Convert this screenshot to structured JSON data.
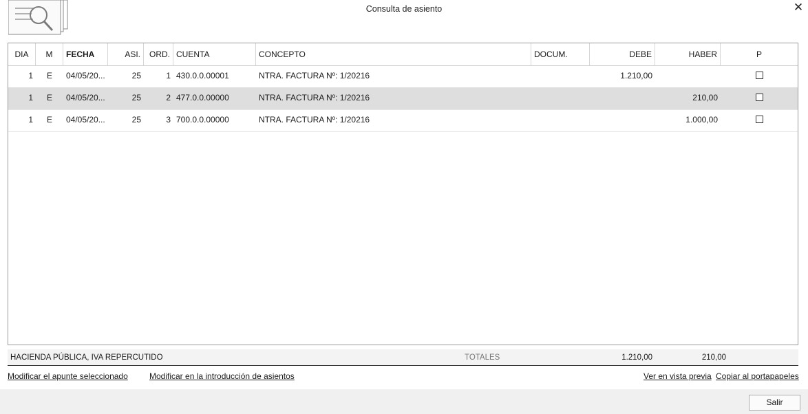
{
  "window": {
    "title": "Consulta de asiento",
    "close_symbol": "✕"
  },
  "columns": [
    "DIA",
    "M",
    "FECHA",
    "ASI.",
    "ORD.",
    "CUENTA",
    "CONCEPTO",
    "DOCUM.",
    "DEBE",
    "HABER",
    "P"
  ],
  "rows": [
    {
      "dia": "1",
      "m": "E",
      "fecha": "04/05/20...",
      "asi": "25",
      "ord": "1",
      "cuenta": "430.0.0.00001",
      "concepto": "NTRA. FACTURA Nº: 1/20216",
      "docum": "",
      "debe": "1.210,00",
      "haber": "",
      "p": false
    },
    {
      "dia": "1",
      "m": "E",
      "fecha": "04/05/20...",
      "asi": "25",
      "ord": "2",
      "cuenta": "477.0.0.00000",
      "concepto": "NTRA. FACTURA Nº: 1/20216",
      "docum": "",
      "debe": "",
      "haber": "210,00",
      "p": false
    },
    {
      "dia": "1",
      "m": "E",
      "fecha": "04/05/20...",
      "asi": "25",
      "ord": "3",
      "cuenta": "700.0.0.00000",
      "concepto": "NTRA. FACTURA Nº: 1/20216",
      "docum": "",
      "debe": "",
      "haber": "1.000,00",
      "p": false
    }
  ],
  "selected_row": 1,
  "footer": {
    "account_name": "HACIENDA PÚBLICA, IVA REPERCUTIDO",
    "totals_label": "TOTALES",
    "total_debe": "1.210,00",
    "total_haber": "210,00"
  },
  "links": {
    "modify_selected": "Modificar el apunte seleccionado",
    "modify_in_entry": "Modificar en la introducción de asientos",
    "preview": "Ver en vista previa",
    "copy_clipboard": "Copiar al portapapeles"
  },
  "buttons": {
    "exit": "Salir"
  },
  "icons": {
    "header_icon": "document-search-icon",
    "close_icon": "close-icon"
  },
  "colors": {
    "selected_row_bg": "#dedede",
    "footer_bg": "#f3f3f3",
    "bottom_bar_bg": "#f0f0f0"
  }
}
